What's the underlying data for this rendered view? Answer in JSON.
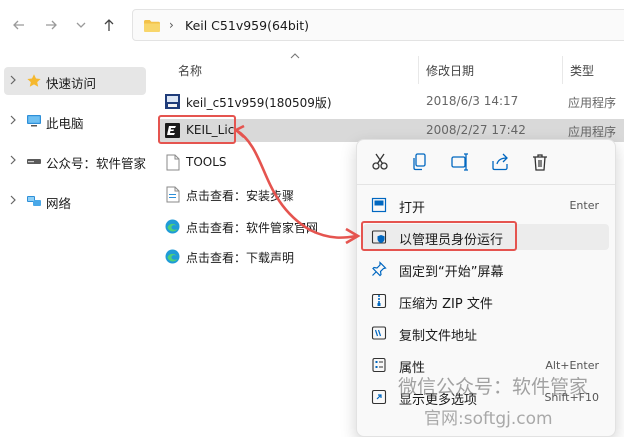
{
  "nav": {
    "back_icon": "arrow-left-icon",
    "forward_icon": "arrow-right-icon",
    "dropdown_icon": "chevron-down-icon",
    "up_icon": "arrow-up-icon"
  },
  "address": {
    "separator": "›",
    "path": "Keil C51v959(64bit)"
  },
  "sidebar": {
    "items": [
      {
        "label": "快速访问",
        "icon": "star-icon"
      },
      {
        "label": "此电脑",
        "icon": "computer-icon"
      },
      {
        "label": "公众号：软件管家",
        "icon": "drive-icon"
      },
      {
        "label": "网络",
        "icon": "network-icon"
      }
    ]
  },
  "columns": {
    "name": "名称",
    "date": "修改日期",
    "type": "类型"
  },
  "files": [
    {
      "name": "keil_c51v959(180509版)",
      "date": "2018/6/3 14:17",
      "type": "应用程序"
    },
    {
      "name": "KEIL_Lic",
      "date": "2008/2/27 17:42",
      "type": "应用程序"
    },
    {
      "name": "TOOLS",
      "date": "",
      "type": ""
    },
    {
      "name": "点击查看：安装步骤",
      "date": "",
      "type": ""
    },
    {
      "name": "点击查看：软件管家官网",
      "date": "",
      "type": ""
    },
    {
      "name": "点击查看：下载声明",
      "date": "",
      "type": ""
    }
  ],
  "context_menu": {
    "quick_actions": [
      "cut-icon",
      "copy-icon",
      "rename-icon",
      "share-icon",
      "delete-icon"
    ],
    "items": [
      {
        "label": "打开",
        "shortcut": "Enter",
        "icon": "open-icon"
      },
      {
        "label": "以管理员身份运行",
        "shortcut": "",
        "icon": "shield-icon"
      },
      {
        "label": "固定到“开始”屏幕",
        "shortcut": "",
        "icon": "pin-icon"
      },
      {
        "label": "压缩为 ZIP 文件",
        "shortcut": "",
        "icon": "zip-icon"
      },
      {
        "label": "复制文件地址",
        "shortcut": "",
        "icon": "copy-path-icon"
      },
      {
        "label": "属性",
        "shortcut": "Alt+Enter",
        "icon": "properties-icon"
      },
      {
        "label": "显示更多选项",
        "shortcut": "Shift+F10",
        "icon": "more-options-icon"
      }
    ]
  },
  "watermark": {
    "line1": "微信公众号：软件管家",
    "line2": "官网:softgj.com"
  },
  "colors": {
    "annotation": "#e5544f",
    "accent": "#0067c0",
    "folder": "#f3c24a"
  }
}
